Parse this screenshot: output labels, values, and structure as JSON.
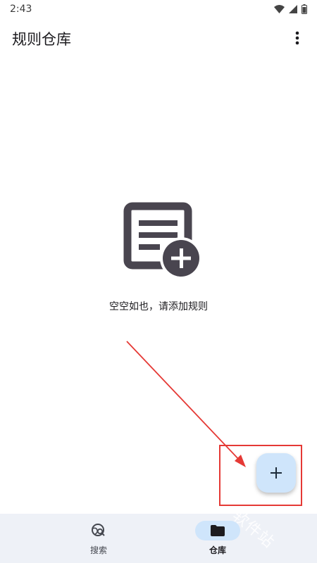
{
  "status_bar": {
    "time": "2:43",
    "icons": [
      "wifi-icon",
      "signal-icon",
      "battery-icon"
    ]
  },
  "app_bar": {
    "title": "规则仓库",
    "menu_icon": "more-vert-icon"
  },
  "empty_state": {
    "icon": "document-add-icon",
    "message": "空空如也，请添加规则"
  },
  "fab": {
    "icon": "plus-icon",
    "label": "+"
  },
  "bottom_nav": {
    "items": [
      {
        "label": "搜索",
        "icon": "search-globe-icon",
        "selected": false
      },
      {
        "label": "仓库",
        "icon": "folder-icon",
        "selected": true
      }
    ]
  },
  "watermark": {
    "text": "软件站"
  },
  "colors": {
    "accent": "#cfe5fb",
    "nav_background": "#eef1f7",
    "illustration": "#49454f",
    "annotation_red": "#e53935"
  }
}
